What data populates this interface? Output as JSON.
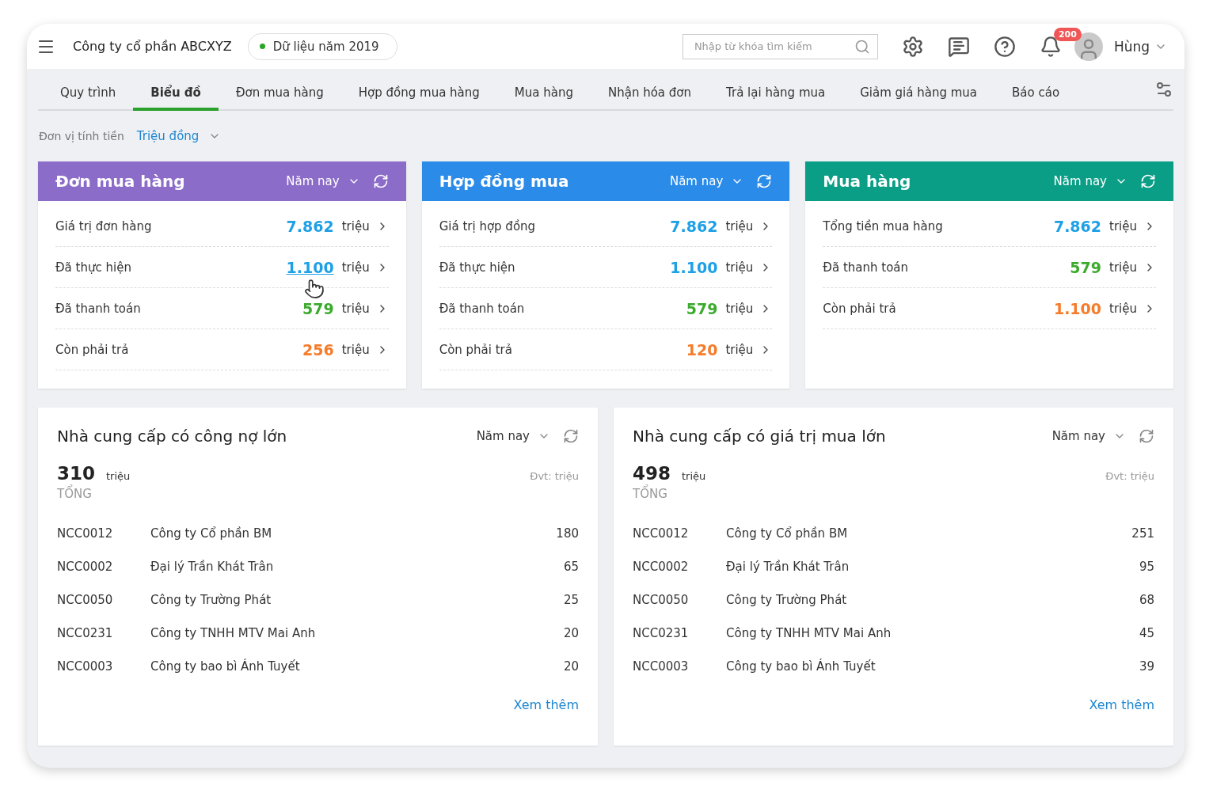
{
  "header": {
    "company": "Công ty cổ phần ABCXYZ",
    "data_year": "Dữ liệu năm 2019",
    "search": {
      "placeholder": "Nhập từ khóa tìm kiếm"
    },
    "notification_count": "200",
    "user": "Hùng"
  },
  "tabs": [
    {
      "label": "Quy trình",
      "selected": false
    },
    {
      "label": "Biểu đồ",
      "selected": true
    },
    {
      "label": "Đơn mua hàng",
      "selected": false
    },
    {
      "label": "Hợp đồng mua hàng",
      "selected": false
    },
    {
      "label": "Mua hàng",
      "selected": false
    },
    {
      "label": "Nhận hóa đơn",
      "selected": false
    },
    {
      "label": "Trả lại hàng mua",
      "selected": false
    },
    {
      "label": "Giảm giá hàng mua",
      "selected": false
    },
    {
      "label": "Báo cáo",
      "selected": false
    }
  ],
  "currency_unit": {
    "label": "Đơn vị tính tiền",
    "value": "Triệu đồng"
  },
  "summary_cards": [
    {
      "title": "Đơn mua hàng",
      "color": "#8c6cc9",
      "period": "Năm nay",
      "rows": [
        {
          "label": "Giá trị đơn hàng",
          "value": "7.862",
          "unit": "triệu",
          "color": "#1ea0e6",
          "hovered": false
        },
        {
          "label": "Đã thực hiện",
          "value": "1.100",
          "unit": "triệu",
          "color": "#1ea0e6",
          "hovered": true
        },
        {
          "label": "Đã thanh toán",
          "value": "579",
          "unit": "triệu",
          "color": "#3cab2d",
          "hovered": false
        },
        {
          "label": "Còn phải trả",
          "value": "256",
          "unit": "triệu",
          "color": "#f47c2a",
          "hovered": false
        }
      ]
    },
    {
      "title": "Hợp đồng mua",
      "color": "#2b8be8",
      "period": "Năm nay",
      "rows": [
        {
          "label": "Giá trị hợp đồng",
          "value": "7.862",
          "unit": "triệu",
          "color": "#1ea0e6",
          "hovered": false
        },
        {
          "label": "Đã thực hiện",
          "value": "1.100",
          "unit": "triệu",
          "color": "#1ea0e6",
          "hovered": false
        },
        {
          "label": "Đã thanh toán",
          "value": "579",
          "unit": "triệu",
          "color": "#3cab2d",
          "hovered": false
        },
        {
          "label": "Còn phải trả",
          "value": "120",
          "unit": "triệu",
          "color": "#f47c2a",
          "hovered": false
        }
      ]
    },
    {
      "title": "Mua hàng",
      "color": "#0a9e86",
      "period": "Năm nay",
      "rows": [
        {
          "label": "Tổng tiền mua hàng",
          "value": "7.862",
          "unit": "triệu",
          "color": "#1ea0e6",
          "hovered": false
        },
        {
          "label": "Đã thanh toán",
          "value": "579",
          "unit": "triệu",
          "color": "#3cab2d",
          "hovered": false
        },
        {
          "label": "Còn phải trả",
          "value": "1.100",
          "unit": "triệu",
          "color": "#f47c2a",
          "hovered": false
        }
      ]
    }
  ],
  "supplier_panels": [
    {
      "title": "Nhà cung cấp có công nợ lớn",
      "period": "Năm nay",
      "total": "310",
      "total_unit": "triệu",
      "total_label": "TỔNG",
      "unit_note": "Đvt: triệu",
      "rows": [
        {
          "code": "NCC0012",
          "name": "Công ty Cổ phần BM",
          "amount": "180"
        },
        {
          "code": "NCC0002",
          "name": "Đại lý Trần Khát Trân",
          "amount": "65"
        },
        {
          "code": "NCC0050",
          "name": "Công ty Trường Phát",
          "amount": "25"
        },
        {
          "code": "NCC0231",
          "name": "Công ty TNHH MTV Mai Anh",
          "amount": "20"
        },
        {
          "code": "NCC0003",
          "name": "Công ty bao bì Ánh Tuyết",
          "amount": "20"
        }
      ],
      "more": "Xem thêm"
    },
    {
      "title": "Nhà cung cấp có giá trị mua lớn",
      "period": "Năm nay",
      "total": "498",
      "total_unit": "triệu",
      "total_label": "TỔNG",
      "unit_note": "Đvt: triệu",
      "rows": [
        {
          "code": "NCC0012",
          "name": "Công ty Cổ phần BM",
          "amount": "251"
        },
        {
          "code": "NCC0002",
          "name": "Đại lý Trần Khát Trân",
          "amount": "95"
        },
        {
          "code": "NCC0050",
          "name": "Công ty Trường Phát",
          "amount": "68"
        },
        {
          "code": "NCC0231",
          "name": "Công ty TNHH MTV Mai Anh",
          "amount": "45"
        },
        {
          "code": "NCC0003",
          "name": "Công ty bao bì Ánh Tuyết",
          "amount": "39"
        }
      ],
      "more": "Xem thêm"
    }
  ]
}
